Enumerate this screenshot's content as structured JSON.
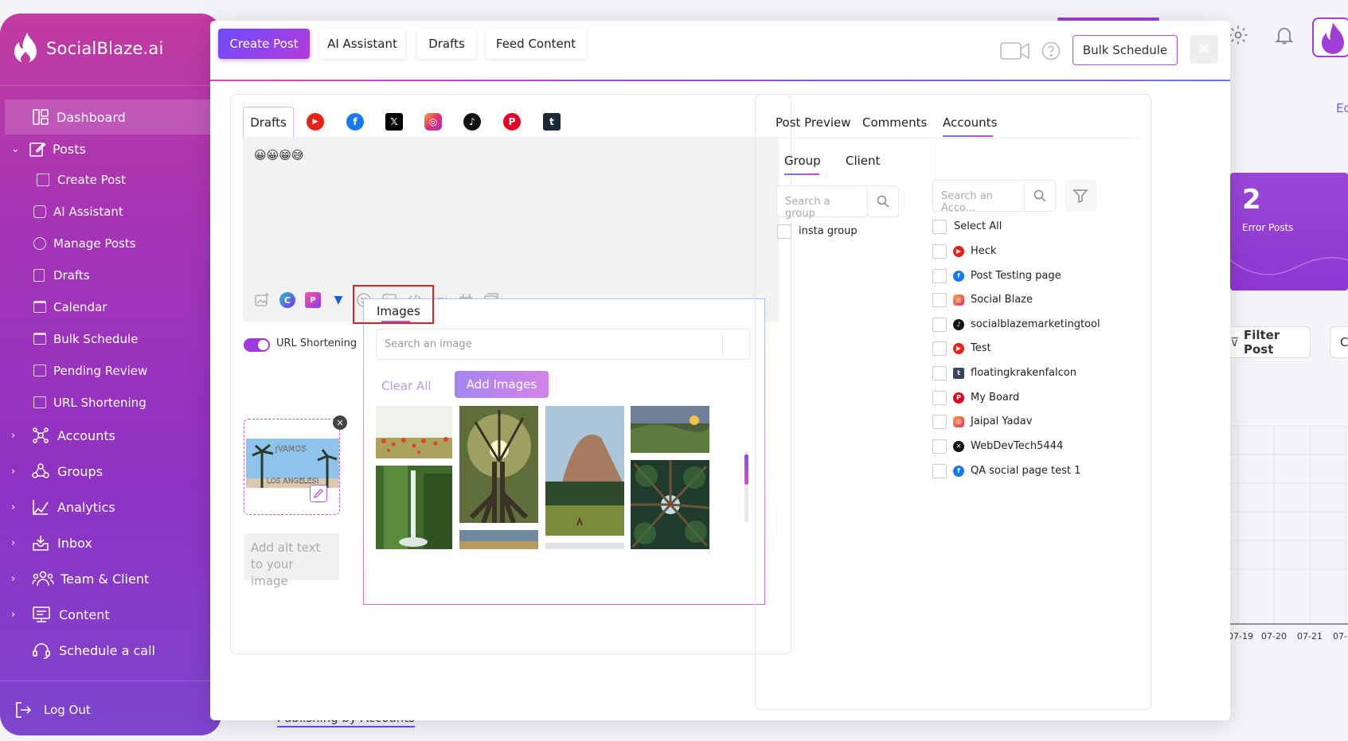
{
  "app": {
    "name": "SocialBlaze.ai"
  },
  "sidebar": {
    "items": [
      {
        "label": "Dashboard",
        "icon": "dashboard-icon",
        "active": true
      },
      {
        "label": "Posts",
        "icon": "edit-icon",
        "expanded": true
      },
      {
        "label": "Create Post",
        "icon": "create-post-icon"
      },
      {
        "label": "AI Assistant",
        "icon": "ai-assistant-icon"
      },
      {
        "label": "Manage Posts",
        "icon": "manage-posts-icon"
      },
      {
        "label": "Drafts",
        "icon": "drafts-icon"
      },
      {
        "label": "Calendar",
        "icon": "calendar-icon"
      },
      {
        "label": "Bulk Schedule",
        "icon": "bulk-schedule-icon"
      },
      {
        "label": "Pending Review",
        "icon": "pending-review-icon"
      },
      {
        "label": "URL Shortening",
        "icon": "url-shortening-icon"
      },
      {
        "label": "Accounts",
        "icon": "accounts-icon"
      },
      {
        "label": "Groups",
        "icon": "groups-icon"
      },
      {
        "label": "Analytics",
        "icon": "analytics-icon"
      },
      {
        "label": "Inbox",
        "icon": "inbox-icon"
      },
      {
        "label": "Team & Client",
        "icon": "team-icon"
      },
      {
        "label": "Content",
        "icon": "content-icon"
      },
      {
        "label": "Schedule a call",
        "icon": "headset-icon"
      }
    ],
    "logout": "Log Out"
  },
  "backdrop": {
    "card_count": "2",
    "card_label": "Error Posts",
    "edit_link": "Ec",
    "filter_post": "Filter Post",
    "cut_button": "Cu",
    "chart_dates": [
      "07-19",
      "07-20",
      "07-21",
      "07-"
    ],
    "bottom_text": "Publishing by Accounts"
  },
  "modal": {
    "tabs": [
      "Create Post",
      "AI Assistant",
      "Drafts",
      "Feed Content"
    ],
    "bulk_schedule": "Bulk Schedule",
    "editor": {
      "active_tab": "Drafts",
      "platforms": [
        "youtube",
        "facebook",
        "x",
        "instagram",
        "tiktok",
        "pinterest",
        "tumblr"
      ],
      "content": "😀😀😁😅",
      "url_shortening_label": "URL Shortening",
      "url_shortening_on": true,
      "thumb_text_top": "¡VAMOS",
      "thumb_text_bottom": "LOS ANGELES!",
      "alt_placeholder": "Add alt text to your image"
    },
    "images_panel": {
      "tab": "Images",
      "search_placeholder": "Search an image",
      "clear_all": "Clear All",
      "add_images": "Add Images"
    },
    "right": {
      "tabs": [
        "Post Preview",
        "Comments",
        "Accounts"
      ],
      "active_tab": "Accounts",
      "subtabs": [
        "Group",
        "Client"
      ],
      "active_subtab": "Group",
      "group_search_placeholder": "Search a group",
      "account_search_placeholder": "Search an Acco...",
      "groups": [
        "insta group"
      ],
      "select_all": "Select All",
      "accounts": [
        {
          "name": "Heck",
          "platform": "youtube",
          "color": "#e62117"
        },
        {
          "name": "Post Testing page",
          "platform": "facebook",
          "color": "#1877f2"
        },
        {
          "name": "Social Blaze",
          "platform": "instagram",
          "color": "#e1306c"
        },
        {
          "name": "socialblazemarketingtool",
          "platform": "tiktok",
          "color": "#111111"
        },
        {
          "name": "Test",
          "platform": "youtube",
          "color": "#e62117"
        },
        {
          "name": "floatingkrakenfalcon",
          "platform": "tumblr",
          "color": "#36465d"
        },
        {
          "name": "My Board",
          "platform": "pinterest",
          "color": "#e60023"
        },
        {
          "name": "Jaipal Yadav",
          "platform": "instagram",
          "color": "#e1306c"
        },
        {
          "name": "WebDevTech5444",
          "platform": "x",
          "color": "#111111"
        },
        {
          "name": "QA social page test 1",
          "platform": "facebook",
          "color": "#1877f2"
        }
      ]
    }
  }
}
